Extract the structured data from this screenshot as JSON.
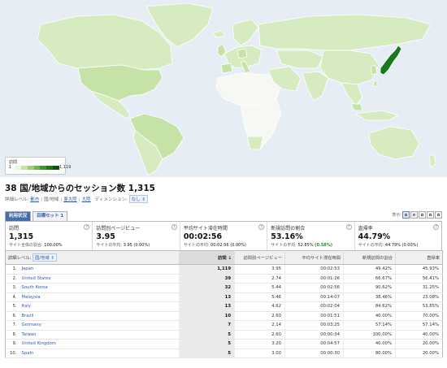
{
  "map": {
    "legend_title": "訪問",
    "legend_min": "1",
    "legend_max": "1,119",
    "colors": {
      "ocean": "#e6edf5",
      "low": "#d6ecc0",
      "mid": "#c5e3a6",
      "no_data": "#f6f8f4",
      "high": "#1a7a1a",
      "border": "#ffffff"
    }
  },
  "header": {
    "title": "38 国/地域からのセッション数 1,315",
    "detail_label": "詳細レベル:",
    "detail_links": [
      "都市",
      "国/地域",
      "亜大陸",
      "大陸"
    ],
    "dimension_label": "ディメンション:",
    "dimension_value": "なし"
  },
  "tabs": [
    "利用状況",
    "目標セット 1"
  ],
  "view_label": "表示:",
  "metrics": [
    {
      "label": "訪問",
      "value": "1,315",
      "sub_label": "サイト全体の割合: ",
      "sub_value": "100.00%",
      "sub_extra": ""
    },
    {
      "label": "訪問別ページビュー",
      "value": "3.95",
      "sub_label": "サイトの平均: ",
      "sub_value": "3.95 (0.00%)",
      "sub_extra": ""
    },
    {
      "label": "平均サイト滞在時間",
      "value": "00:02:56",
      "sub_label": "サイトの平均: ",
      "sub_value": "00:02:56 (0.00%)",
      "sub_extra": ""
    },
    {
      "label": "新規訪問の割合",
      "value": "53.16%",
      "sub_label": "サイトの平均: ",
      "sub_value": "52.85% ",
      "sub_extra": "(0.58%)"
    },
    {
      "label": "直帰率",
      "value": "44.79%",
      "sub_label": "サイトの平均: ",
      "sub_value": "44.79% (0.00%)",
      "sub_extra": ""
    }
  ],
  "table": {
    "dim_label": "詳細レベル:",
    "dim_value": "国/地域",
    "columns": [
      "訪問 ↓",
      "訪問別ページビュー",
      "平均サイト滞在時間",
      "新規訪問の割合",
      "直帰率"
    ],
    "rows": [
      {
        "num": "1.",
        "country": "Japan",
        "visits": "1,119",
        "ppv": "3.95",
        "time": "00:02:53",
        "new": "49.42%",
        "bounce": "45.93%"
      },
      {
        "num": "2.",
        "country": "United States",
        "visits": "39",
        "ppv": "2.74",
        "time": "00:01:26",
        "new": "66.67%",
        "bounce": "56.41%"
      },
      {
        "num": "3.",
        "country": "South Korea",
        "visits": "32",
        "ppv": "5.44",
        "time": "00:02:56",
        "new": "90.62%",
        "bounce": "31.25%"
      },
      {
        "num": "4.",
        "country": "Malaysia",
        "visits": "13",
        "ppv": "5.46",
        "time": "00:14:07",
        "new": "38.46%",
        "bounce": "23.08%"
      },
      {
        "num": "5.",
        "country": "Italy",
        "visits": "13",
        "ppv": "4.62",
        "time": "00:02:04",
        "new": "84.62%",
        "bounce": "53.85%"
      },
      {
        "num": "6.",
        "country": "Brazil",
        "visits": "10",
        "ppv": "2.60",
        "time": "00:01:51",
        "new": "40.00%",
        "bounce": "70.00%"
      },
      {
        "num": "7.",
        "country": "Germany",
        "visits": "7",
        "ppv": "2.14",
        "time": "00:03:25",
        "new": "57.14%",
        "bounce": "57.14%"
      },
      {
        "num": "8.",
        "country": "Taiwan",
        "visits": "5",
        "ppv": "2.60",
        "time": "00:00:34",
        "new": "100.00%",
        "bounce": "40.00%"
      },
      {
        "num": "9.",
        "country": "United Kingdom",
        "visits": "5",
        "ppv": "3.20",
        "time": "00:04:57",
        "new": "40.00%",
        "bounce": "20.00%"
      },
      {
        "num": "10.",
        "country": "Spain",
        "visits": "5",
        "ppv": "3.00",
        "time": "00:00:30",
        "new": "80.00%",
        "bounce": "20.00%"
      }
    ]
  }
}
